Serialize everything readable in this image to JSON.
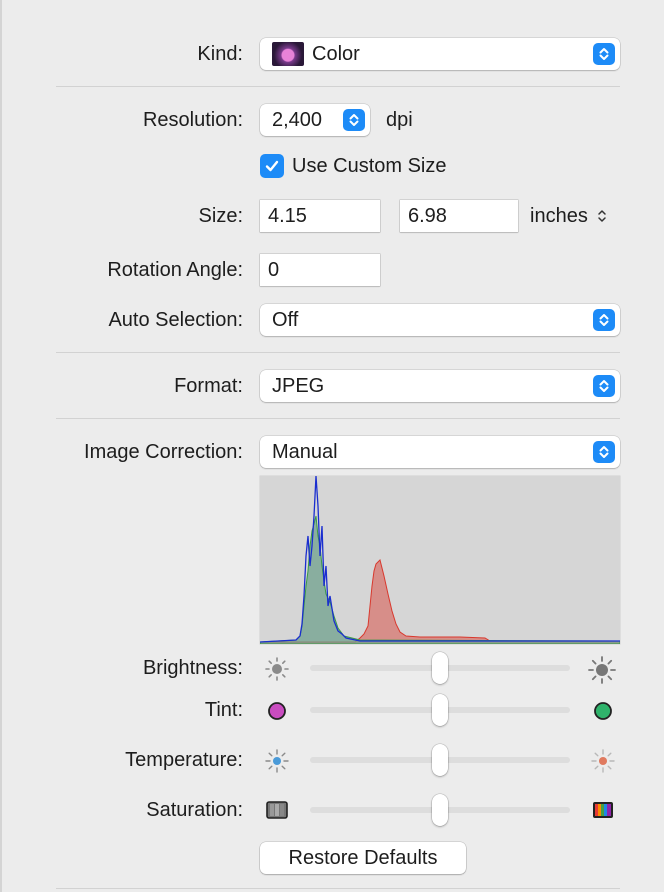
{
  "kind": {
    "label": "Kind:",
    "value": "Color",
    "icon": "lotus-thumbnail-icon"
  },
  "resolution": {
    "label": "Resolution:",
    "value": "2,400",
    "unit": "dpi"
  },
  "custom_size": {
    "label": "Use Custom Size",
    "checked": true
  },
  "size": {
    "label": "Size:",
    "width": "4.15",
    "height": "6.98",
    "unit": "inches"
  },
  "rotation": {
    "label": "Rotation Angle:",
    "value": "0"
  },
  "auto_selection": {
    "label": "Auto Selection:",
    "value": "Off"
  },
  "format": {
    "label": "Format:",
    "value": "JPEG"
  },
  "image_correction": {
    "label": "Image Correction:",
    "value": "Manual"
  },
  "sliders": {
    "brightness": {
      "label": "Brightness:",
      "level": 0.5,
      "left_icon": "sun-dim-icon",
      "right_icon": "sun-bright-icon"
    },
    "tint": {
      "label": "Tint:",
      "level": 0.5,
      "left_icon": "magenta-circle-icon",
      "right_icon": "green-circle-icon"
    },
    "temperature": {
      "label": "Temperature:",
      "level": 0.5,
      "left_icon": "cool-sun-icon",
      "right_icon": "warm-sun-icon"
    },
    "saturation": {
      "label": "Saturation:",
      "level": 0.5,
      "left_icon": "gray-swatch-icon",
      "right_icon": "rainbow-swatch-icon"
    }
  },
  "restore_button": {
    "label": "Restore Defaults"
  },
  "colors": {
    "accent": "#1d8bf7",
    "background": "#ececec"
  }
}
